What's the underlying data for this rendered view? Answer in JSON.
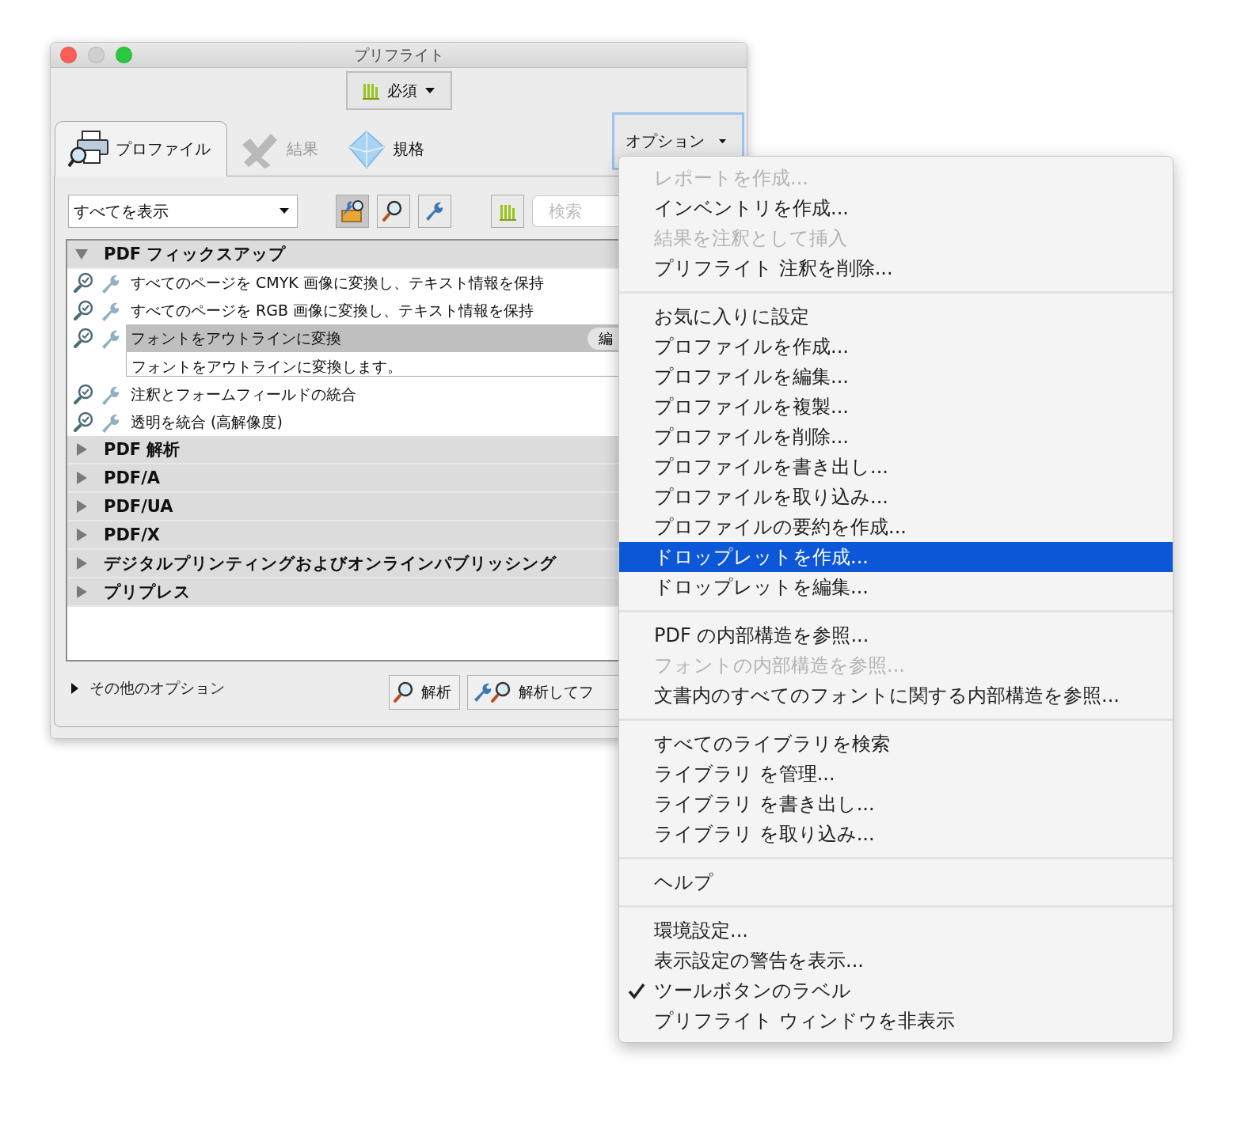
{
  "window": {
    "title": "プリフライト"
  },
  "profile_selector": {
    "label": "必須"
  },
  "tabs": [
    {
      "label": "プロファイル",
      "kind": "profiles",
      "selected": true,
      "disabled": false
    },
    {
      "label": "結果",
      "kind": "results",
      "selected": false,
      "disabled": true
    },
    {
      "label": "規格",
      "kind": "standards",
      "selected": false,
      "disabled": false
    }
  ],
  "options_button": {
    "label": "オプション"
  },
  "filter": {
    "value": "すべてを表示"
  },
  "search": {
    "placeholder": "検索"
  },
  "tree": [
    {
      "label": "PDF フィックスアップ",
      "expanded": true,
      "children": [
        {
          "label": "すべてのページを CMYK 画像に変換し、テキスト情報を保持",
          "selected": false
        },
        {
          "label": "すべてのページを RGB 画像に変換し、テキスト情報を保持",
          "selected": false
        },
        {
          "label": "フォントをアウトラインに変換",
          "selected": true,
          "description": "フォントをアウトラインに変換します。",
          "edit_label": "編"
        },
        {
          "label": "注釈とフォームフィールドの統合",
          "selected": false
        },
        {
          "label": "透明を統合 (高解像度)",
          "selected": false
        }
      ]
    },
    {
      "label": "PDF 解析",
      "expanded": false
    },
    {
      "label": "PDF/A",
      "expanded": false
    },
    {
      "label": "PDF/UA",
      "expanded": false
    },
    {
      "label": "PDF/X",
      "expanded": false
    },
    {
      "label": "デジタルプリンティングおよびオンラインパブリッシング",
      "expanded": false
    },
    {
      "label": "プリプレス",
      "expanded": false
    }
  ],
  "more_options": {
    "label": "その他のオプション",
    "expanded": false
  },
  "buttons": [
    {
      "label": "解析",
      "kind": "analyze"
    },
    {
      "label": "解析してフ",
      "kind": "analyze-fix"
    }
  ],
  "menu": {
    "sections": [
      [
        {
          "label": "レポートを作成...",
          "disabled": true,
          "selected": false,
          "checked": false
        },
        {
          "label": "インベントリを作成...",
          "disabled": false,
          "selected": false,
          "checked": false
        },
        {
          "label": "結果を注釈として挿入",
          "disabled": true,
          "selected": false,
          "checked": false
        },
        {
          "label": "プリフライト 注釈を削除...",
          "disabled": false,
          "selected": false,
          "checked": false
        }
      ],
      [
        {
          "label": "お気に入りに設定",
          "disabled": false,
          "selected": false,
          "checked": false
        },
        {
          "label": "プロファイルを作成...",
          "disabled": false,
          "selected": false,
          "checked": false
        },
        {
          "label": "プロファイルを編集...",
          "disabled": false,
          "selected": false,
          "checked": false
        },
        {
          "label": "プロファイルを複製...",
          "disabled": false,
          "selected": false,
          "checked": false
        },
        {
          "label": "プロファイルを削除...",
          "disabled": false,
          "selected": false,
          "checked": false
        },
        {
          "label": "プロファイルを書き出し...",
          "disabled": false,
          "selected": false,
          "checked": false
        },
        {
          "label": "プロファイルを取り込み...",
          "disabled": false,
          "selected": false,
          "checked": false
        },
        {
          "label": "プロファイルの要約を作成...",
          "disabled": false,
          "selected": false,
          "checked": false
        },
        {
          "label": "ドロップレットを作成...",
          "disabled": false,
          "selected": true,
          "checked": false
        },
        {
          "label": "ドロップレットを編集...",
          "disabled": false,
          "selected": false,
          "checked": false
        }
      ],
      [
        {
          "label": "PDF の内部構造を参照...",
          "disabled": false,
          "selected": false,
          "checked": false
        },
        {
          "label": "フォントの内部構造を参照...",
          "disabled": true,
          "selected": false,
          "checked": false
        },
        {
          "label": "文書内のすべてのフォントに関する内部構造を参照...",
          "disabled": false,
          "selected": false,
          "checked": false
        }
      ],
      [
        {
          "label": "すべてのライブラリを検索",
          "disabled": false,
          "selected": false,
          "checked": false
        },
        {
          "label": "ライブラリ を管理...",
          "disabled": false,
          "selected": false,
          "checked": false
        },
        {
          "label": "ライブラリ を書き出し...",
          "disabled": false,
          "selected": false,
          "checked": false
        },
        {
          "label": "ライブラリ を取り込み...",
          "disabled": false,
          "selected": false,
          "checked": false
        }
      ],
      [
        {
          "label": "ヘルプ",
          "disabled": false,
          "selected": false,
          "checked": false
        }
      ],
      [
        {
          "label": "環境設定...",
          "disabled": false,
          "selected": false,
          "checked": false
        },
        {
          "label": "表示設定の警告を表示...",
          "disabled": false,
          "selected": false,
          "checked": false
        },
        {
          "label": "ツールボタンのラベル",
          "disabled": false,
          "selected": false,
          "checked": true
        },
        {
          "label": "プリフライト ウィンドウを非表示",
          "disabled": false,
          "selected": false,
          "checked": false
        }
      ]
    ]
  }
}
